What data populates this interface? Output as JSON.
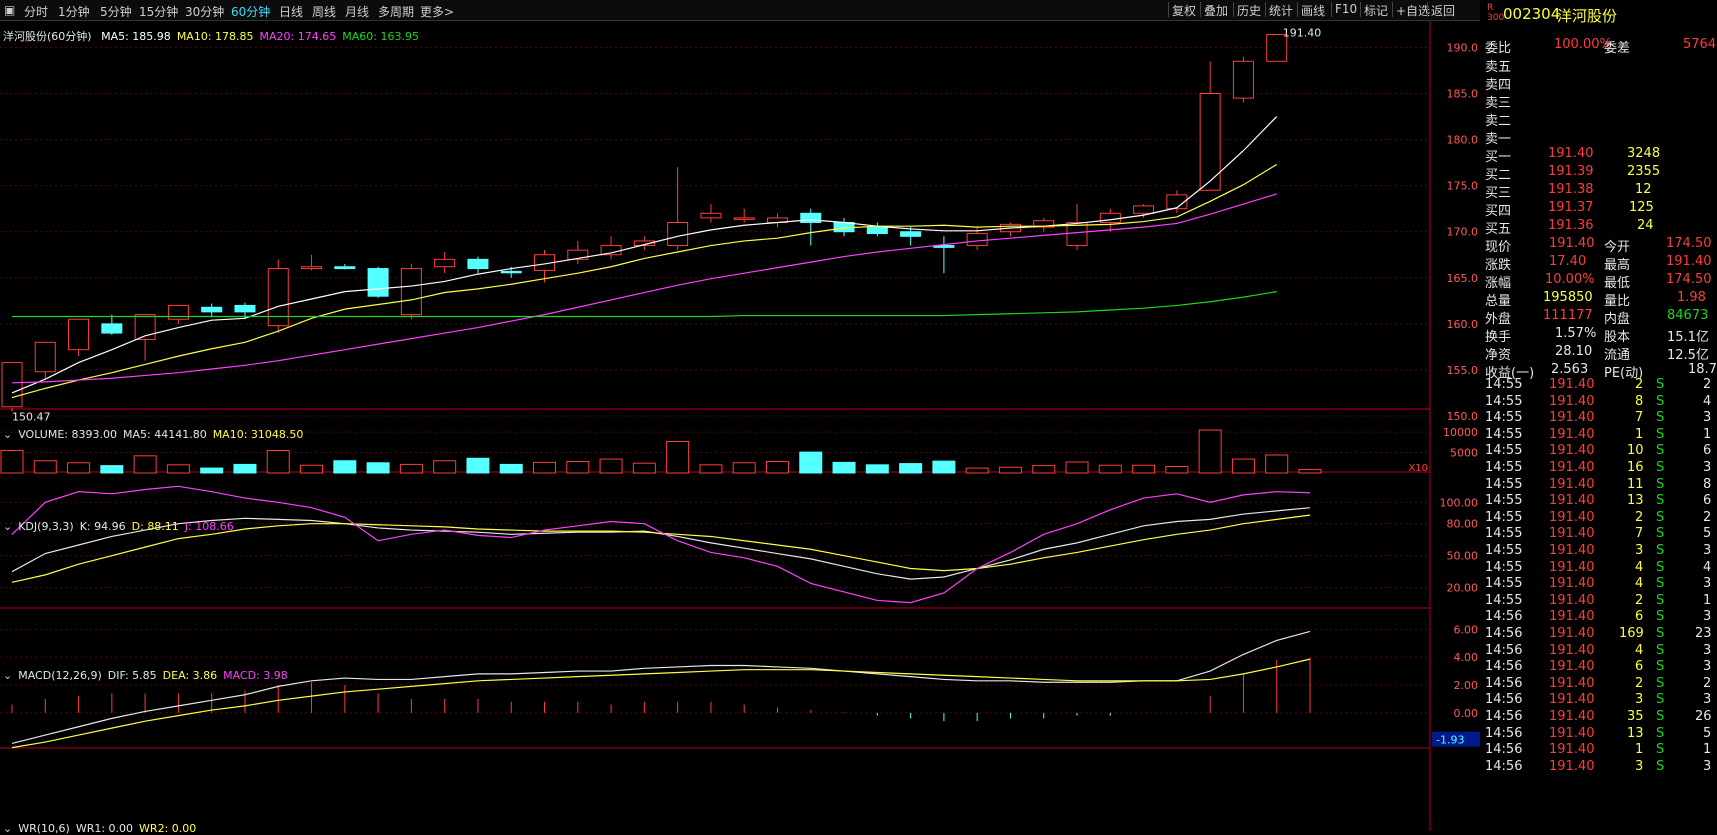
{
  "toolbar": {
    "periods": [
      "分时",
      "1分钟",
      "5分钟",
      "15分钟",
      "30分钟",
      "60分钟",
      "日线",
      "周线",
      "月线",
      "多周期",
      "更多>"
    ],
    "active_period": "60分钟",
    "right_buttons": [
      "复权",
      "叠加",
      "历史",
      "统计",
      "画线",
      "F10",
      "标记",
      "+自选",
      "返回"
    ]
  },
  "main": {
    "title": "洋河股份(60分钟)",
    "ma": [
      {
        "label": "MA5: 185.98",
        "color": "#ffffff"
      },
      {
        "label": "MA10: 178.85",
        "color": "#ffff40"
      },
      {
        "label": "MA20: 174.65",
        "color": "#ff40ff"
      },
      {
        "label": "MA60: 163.95",
        "color": "#1cd81c"
      }
    ],
    "high_label": "191.40",
    "low_label": "150.47",
    "y_ticks": [
      "190.0",
      "185.0",
      "180.0",
      "175.0",
      "170.0",
      "165.0",
      "160.0",
      "155.0",
      "150.0"
    ]
  },
  "volume": {
    "legend": [
      {
        "label": "VOLUME: 8393.00",
        "color": "#e6e6e6"
      },
      {
        "label": "MA5: 44141.80",
        "color": "#e6e6e6"
      },
      {
        "label": "MA10: 31048.50",
        "color": "#ffff40"
      }
    ],
    "y_ticks": [
      "10000",
      "5000"
    ],
    "unit": "X10"
  },
  "kdj": {
    "legend": [
      {
        "label": "KDJ(9,3,3)",
        "color": "#e6e6e6"
      },
      {
        "label": "K: 94.96",
        "color": "#e6e6e6"
      },
      {
        "label": "D: 88.11",
        "color": "#ffff40"
      },
      {
        "label": "J: 108.66",
        "color": "#ff40ff"
      }
    ],
    "y_ticks": [
      "100.00",
      "80.00",
      "50.00",
      "20.00"
    ]
  },
  "macd": {
    "legend": [
      {
        "label": "MACD(12,26,9)",
        "color": "#e6e6e6"
      },
      {
        "label": "DIF: 5.85",
        "color": "#e6e6e6"
      },
      {
        "label": "DEA: 3.86",
        "color": "#ffff40"
      },
      {
        "label": "MACD: 3.98",
        "color": "#ff40ff"
      }
    ],
    "y_ticks": [
      "6.00",
      "4.00",
      "2.00",
      "0.00"
    ],
    "neg_label": "-1.93"
  },
  "wr": {
    "legend": [
      {
        "label": "WR(10,6)",
        "color": "#e6e6e6"
      },
      {
        "label": "WR1: 0.00",
        "color": "#e6e6e6"
      },
      {
        "label": "WR2: 0.00",
        "color": "#ffff40"
      }
    ]
  },
  "quote": {
    "code": "002304",
    "name": "洋河股份",
    "weibi_label": "委比",
    "weibi": "100.00%",
    "weicha_label": "委差",
    "weicha": "5764",
    "asks": [
      {
        "label": "卖五"
      },
      {
        "label": "卖四"
      },
      {
        "label": "卖三"
      },
      {
        "label": "卖二"
      },
      {
        "label": "卖一"
      }
    ],
    "bids": [
      {
        "label": "买一",
        "price": "191.40",
        "vol": "3248"
      },
      {
        "label": "买二",
        "price": "191.39",
        "vol": "2355"
      },
      {
        "label": "买三",
        "price": "191.38",
        "vol": "12"
      },
      {
        "label": "买四",
        "price": "191.37",
        "vol": "125"
      },
      {
        "label": "买五",
        "price": "191.36",
        "vol": "24"
      }
    ],
    "stats": [
      {
        "l1": "现价",
        "v1": "191.40",
        "c1": "red",
        "l2": "今开",
        "v2": "174.50",
        "c2": "red"
      },
      {
        "l1": "涨跌",
        "v1": "17.40",
        "c1": "red",
        "l2": "最高",
        "v2": "191.40",
        "c2": "red"
      },
      {
        "l1": "涨幅",
        "v1": "10.00%",
        "c1": "red",
        "l2": "最低",
        "v2": "174.50",
        "c2": "red"
      },
      {
        "l1": "总量",
        "v1": "195850",
        "c1": "yel",
        "l2": "量比",
        "v2": "1.98",
        "c2": "red"
      },
      {
        "l1": "外盘",
        "v1": "111177",
        "c1": "red",
        "l2": "内盘",
        "v2": "84673",
        "c2": "grn"
      }
    ],
    "stats2": [
      {
        "l1": "换手",
        "v1": "1.57%",
        "l2": "股本",
        "v2": "15.1亿"
      },
      {
        "l1": "净资",
        "v1": "28.10",
        "l2": "流通",
        "v2": "12.5亿"
      },
      {
        "l1": "收益(一)",
        "v1": "2.563",
        "l2": "PE(动)",
        "v2": "18.7"
      }
    ],
    "trades": [
      {
        "t": "14:55",
        "p": "191.40",
        "v": "2",
        "bs": "S",
        "n": "2"
      },
      {
        "t": "14:55",
        "p": "191.40",
        "v": "8",
        "bs": "S",
        "n": "4"
      },
      {
        "t": "14:55",
        "p": "191.40",
        "v": "7",
        "bs": "S",
        "n": "3"
      },
      {
        "t": "14:55",
        "p": "191.40",
        "v": "1",
        "bs": "S",
        "n": "1"
      },
      {
        "t": "14:55",
        "p": "191.40",
        "v": "10",
        "bs": "S",
        "n": "6"
      },
      {
        "t": "14:55",
        "p": "191.40",
        "v": "16",
        "bs": "S",
        "n": "3"
      },
      {
        "t": "14:55",
        "p": "191.40",
        "v": "11",
        "bs": "S",
        "n": "8"
      },
      {
        "t": "14:55",
        "p": "191.40",
        "v": "13",
        "bs": "S",
        "n": "6"
      },
      {
        "t": "14:55",
        "p": "191.40",
        "v": "2",
        "bs": "S",
        "n": "2"
      },
      {
        "t": "14:55",
        "p": "191.40",
        "v": "7",
        "bs": "S",
        "n": "5"
      },
      {
        "t": "14:55",
        "p": "191.40",
        "v": "3",
        "bs": "S",
        "n": "3"
      },
      {
        "t": "14:55",
        "p": "191.40",
        "v": "4",
        "bs": "S",
        "n": "4"
      },
      {
        "t": "14:55",
        "p": "191.40",
        "v": "4",
        "bs": "S",
        "n": "3"
      },
      {
        "t": "14:55",
        "p": "191.40",
        "v": "2",
        "bs": "S",
        "n": "1"
      },
      {
        "t": "14:56",
        "p": "191.40",
        "v": "6",
        "bs": "S",
        "n": "3"
      },
      {
        "t": "14:56",
        "p": "191.40",
        "v": "169",
        "bs": "S",
        "n": "23"
      },
      {
        "t": "14:56",
        "p": "191.40",
        "v": "4",
        "bs": "S",
        "n": "3"
      },
      {
        "t": "14:56",
        "p": "191.40",
        "v": "6",
        "bs": "S",
        "n": "3"
      },
      {
        "t": "14:56",
        "p": "191.40",
        "v": "2",
        "bs": "S",
        "n": "2"
      },
      {
        "t": "14:56",
        "p": "191.40",
        "v": "3",
        "bs": "S",
        "n": "3"
      },
      {
        "t": "14:56",
        "p": "191.40",
        "v": "35",
        "bs": "S",
        "n": "26"
      },
      {
        "t": "14:56",
        "p": "191.40",
        "v": "13",
        "bs": "S",
        "n": "5"
      },
      {
        "t": "14:56",
        "p": "191.40",
        "v": "1",
        "bs": "S",
        "n": "1"
      },
      {
        "t": "14:56",
        "p": "191.40",
        "v": "3",
        "bs": "S",
        "n": "3"
      }
    ]
  },
  "chart_data": {
    "type": "candlestick",
    "ylim": [
      150,
      192
    ],
    "candles": [
      [
        151.0,
        155.8,
        150.47,
        150.9
      ],
      [
        154.8,
        158.0,
        154.0,
        155.2
      ],
      [
        157.2,
        160.5,
        156.5,
        160.2
      ],
      [
        160.0,
        159.0,
        161.0,
        158.8
      ],
      [
        158.3,
        161.0,
        156.0,
        160.7
      ],
      [
        160.5,
        162.0,
        160.0,
        161.8
      ],
      [
        161.8,
        161.3,
        162.2,
        160.7
      ],
      [
        162.0,
        161.3,
        162.3,
        160.5
      ],
      [
        159.8,
        166.0,
        159.0,
        167.0
      ],
      [
        166.0,
        166.2,
        165.8,
        167.5
      ],
      [
        166.2,
        166.0,
        166.5,
        165.9
      ],
      [
        166.0,
        163.0,
        166.2,
        162.8
      ],
      [
        161.0,
        166.0,
        160.5,
        166.5
      ],
      [
        166.2,
        167.0,
        165.5,
        167.8
      ],
      [
        167.0,
        166.0,
        167.3,
        165.5
      ],
      [
        165.7,
        165.6,
        166.2,
        165.0
      ],
      [
        165.8,
        167.5,
        164.5,
        168.0
      ],
      [
        167.0,
        168.0,
        166.5,
        169.0
      ],
      [
        167.5,
        168.5,
        167.0,
        169.5
      ],
      [
        168.5,
        169.0,
        168.0,
        169.5
      ],
      [
        168.5,
        171.0,
        168.0,
        177.0
      ],
      [
        171.5,
        172.0,
        171.0,
        173.0
      ],
      [
        171.5,
        171.5,
        171.0,
        172.5
      ],
      [
        171.0,
        171.5,
        170.5,
        172.0
      ],
      [
        172.0,
        171.0,
        172.5,
        168.5
      ],
      [
        171.0,
        170.0,
        171.5,
        169.5
      ],
      [
        170.5,
        169.8,
        171.0,
        169.5
      ],
      [
        170.0,
        169.5,
        170.5,
        168.5
      ],
      [
        168.5,
        168.3,
        169.5,
        165.5
      ],
      [
        168.5,
        169.8,
        168.0,
        170.5
      ],
      [
        170.0,
        170.8,
        169.5,
        171.0
      ],
      [
        170.5,
        171.2,
        170.0,
        171.5
      ],
      [
        168.5,
        171.0,
        168.0,
        173.0
      ],
      [
        171.0,
        172.0,
        170.0,
        172.5
      ],
      [
        172.0,
        172.8,
        171.5,
        173.0
      ],
      [
        172.5,
        174.0,
        172.0,
        174.5
      ],
      [
        174.5,
        185.0,
        174.5,
        188.5
      ],
      [
        184.5,
        188.5,
        184.0,
        189.0
      ],
      [
        188.5,
        191.4,
        188.5,
        191.4
      ]
    ],
    "ma5": [
      152.5,
      154.0,
      155.8,
      157.2,
      158.7,
      159.6,
      160.4,
      160.6,
      161.9,
      162.7,
      163.5,
      163.8,
      164.1,
      164.6,
      165.4,
      166.0,
      166.5,
      167.1,
      167.7,
      168.6,
      169.5,
      170.2,
      170.7,
      171.0,
      171.3,
      171.0,
      170.6,
      170.3,
      170.1,
      170.1,
      170.4,
      170.6,
      170.9,
      171.3,
      171.8,
      172.6,
      175.5,
      178.8,
      182.5
    ],
    "ma10": [
      152.0,
      153.0,
      153.9,
      154.7,
      155.6,
      156.5,
      157.3,
      158.0,
      159.2,
      160.6,
      161.6,
      162.1,
      162.6,
      163.4,
      163.8,
      164.3,
      164.9,
      165.5,
      166.2,
      167.1,
      167.8,
      168.5,
      169.0,
      169.3,
      169.9,
      170.4,
      170.6,
      170.6,
      170.7,
      170.5,
      170.6,
      170.6,
      170.7,
      170.8,
      171.1,
      171.6,
      173.3,
      175.1,
      177.3
    ],
    "ma20": [
      153.6,
      153.7,
      153.9,
      154.1,
      154.4,
      154.7,
      155.1,
      155.5,
      156.0,
      156.6,
      157.2,
      157.8,
      158.4,
      159.0,
      159.6,
      160.3,
      161.0,
      161.8,
      162.6,
      163.4,
      164.2,
      164.9,
      165.5,
      166.1,
      166.7,
      167.3,
      167.8,
      168.2,
      168.6,
      169.0,
      169.3,
      169.6,
      169.9,
      170.2,
      170.5,
      170.9,
      171.9,
      173.0,
      174.1
    ],
    "ma60": [
      160.8,
      160.8,
      160.8,
      160.8,
      160.8,
      160.8,
      160.8,
      160.8,
      160.8,
      160.8,
      160.8,
      160.8,
      160.8,
      160.8,
      160.8,
      160.8,
      160.8,
      160.8,
      160.8,
      160.8,
      160.8,
      160.8,
      160.9,
      160.9,
      160.9,
      160.9,
      160.9,
      160.9,
      160.9,
      161.0,
      161.1,
      161.2,
      161.3,
      161.5,
      161.7,
      162.0,
      162.4,
      162.9,
      163.5
    ],
    "volume": [
      5500,
      3000,
      2500,
      1800,
      4200,
      2000,
      1200,
      2100,
      5500,
      1900,
      3000,
      2500,
      2100,
      3000,
      3600,
      2100,
      2600,
      2800,
      3400,
      2400,
      7700,
      2000,
      2500,
      2800,
      5100,
      2600,
      2000,
      2300,
      2900,
      1200,
      1400,
      1800,
      2700,
      1900,
      1900,
      1600,
      10500,
      3400,
      4400,
      840
    ],
    "kdj_k": [
      35,
      52,
      60,
      68,
      74,
      80,
      83,
      85,
      84,
      83,
      80,
      76,
      74,
      73,
      72,
      70,
      71,
      72,
      72,
      73,
      68,
      62,
      57,
      52,
      47,
      40,
      33,
      28,
      30,
      38,
      46,
      56,
      62,
      70,
      78,
      82,
      84,
      89,
      92,
      95
    ],
    "kdj_d": [
      25,
      32,
      42,
      50,
      58,
      66,
      70,
      75,
      78,
      80,
      80,
      79,
      78,
      77,
      75,
      74,
      73,
      73,
      73,
      72,
      70,
      68,
      64,
      60,
      56,
      50,
      44,
      38,
      36,
      38,
      42,
      48,
      53,
      59,
      65,
      70,
      74,
      80,
      84,
      88
    ],
    "kdj_j": [
      70,
      100,
      110,
      108,
      112,
      115,
      110,
      104,
      100,
      95,
      86,
      64,
      70,
      74,
      69,
      67,
      74,
      78,
      82,
      80,
      64,
      53,
      48,
      40,
      24,
      16,
      8,
      6,
      15,
      38,
      53,
      70,
      80,
      93,
      104,
      108,
      100,
      107,
      110,
      109
    ],
    "dif": [
      -2.2,
      -1.6,
      -1.0,
      -0.4,
      0.1,
      0.5,
      0.9,
      1.3,
      1.9,
      2.3,
      2.5,
      2.4,
      2.4,
      2.6,
      2.8,
      2.8,
      2.9,
      3.0,
      3.0,
      3.2,
      3.3,
      3.4,
      3.4,
      3.3,
      3.2,
      3.0,
      2.8,
      2.6,
      2.4,
      2.3,
      2.3,
      2.2,
      2.2,
      2.2,
      2.3,
      2.3,
      3.0,
      4.2,
      5.2,
      5.85
    ],
    "dea": [
      -2.5,
      -2.1,
      -1.6,
      -1.1,
      -0.6,
      -0.2,
      0.2,
      0.5,
      0.9,
      1.2,
      1.5,
      1.7,
      1.9,
      2.1,
      2.3,
      2.4,
      2.5,
      2.6,
      2.7,
      2.8,
      2.9,
      3.0,
      3.1,
      3.1,
      3.1,
      3.0,
      2.9,
      2.8,
      2.7,
      2.6,
      2.5,
      2.4,
      2.3,
      2.3,
      2.3,
      2.3,
      2.4,
      2.8,
      3.3,
      3.86
    ],
    "macd_bar": [
      0.6,
      1.0,
      1.2,
      1.4,
      1.4,
      1.4,
      1.4,
      1.6,
      2.0,
      2.2,
      2.0,
      1.4,
      1.0,
      1.0,
      1.0,
      0.8,
      0.8,
      0.8,
      0.6,
      0.8,
      0.8,
      0.8,
      0.6,
      0.4,
      0.2,
      0.05,
      -0.2,
      -0.4,
      -0.6,
      -0.6,
      -0.4,
      -0.4,
      -0.2,
      -0.2,
      0.0,
      0.0,
      1.2,
      2.8,
      3.8,
      3.98
    ]
  }
}
